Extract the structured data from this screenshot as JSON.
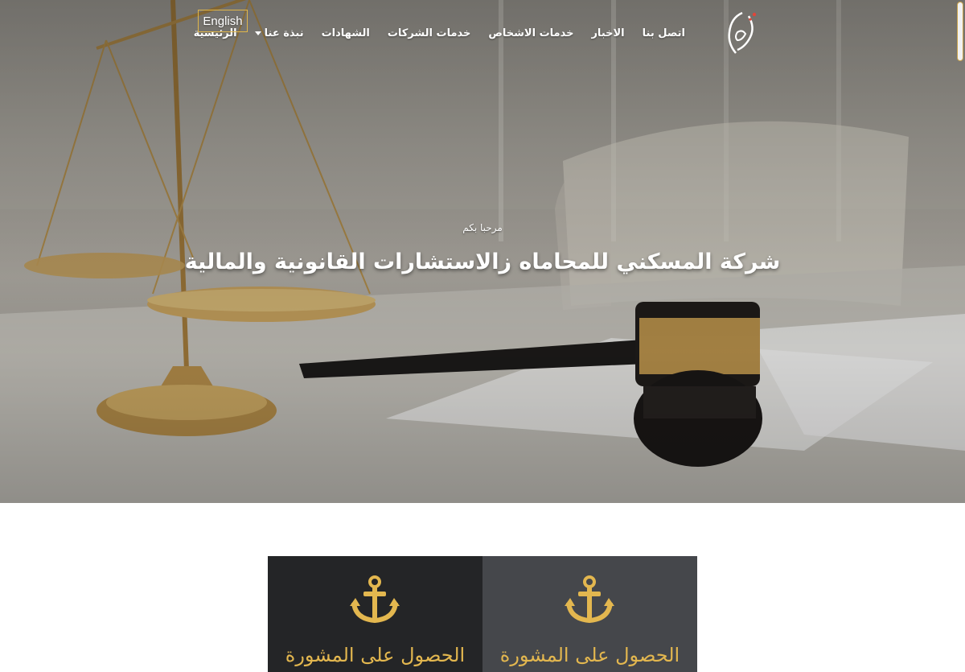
{
  "nav": {
    "items": [
      {
        "label": "الرئيسية"
      },
      {
        "label": "نبذة عنا",
        "has_dropdown": true
      },
      {
        "label": "الشهادات"
      },
      {
        "label": "خدمات الشركات"
      },
      {
        "label": "خدمات الاشخاص"
      },
      {
        "label": "الاخبار"
      },
      {
        "label": "اتصل بنا"
      }
    ],
    "language_button": "English"
  },
  "hero": {
    "eyebrow": "مرحبا بكم",
    "title": "شركة المسكني للمحاماه زالاستشارات القانونية والمالية"
  },
  "services": [
    {
      "icon": "anchor-icon",
      "title": "الحصول على المشورة"
    },
    {
      "icon": "anchor-icon",
      "title": "الحصول على المشورة"
    }
  ],
  "colors": {
    "accent_gold": "#e3b74f",
    "card_dark": "#242527",
    "card_light": "#45474b"
  }
}
